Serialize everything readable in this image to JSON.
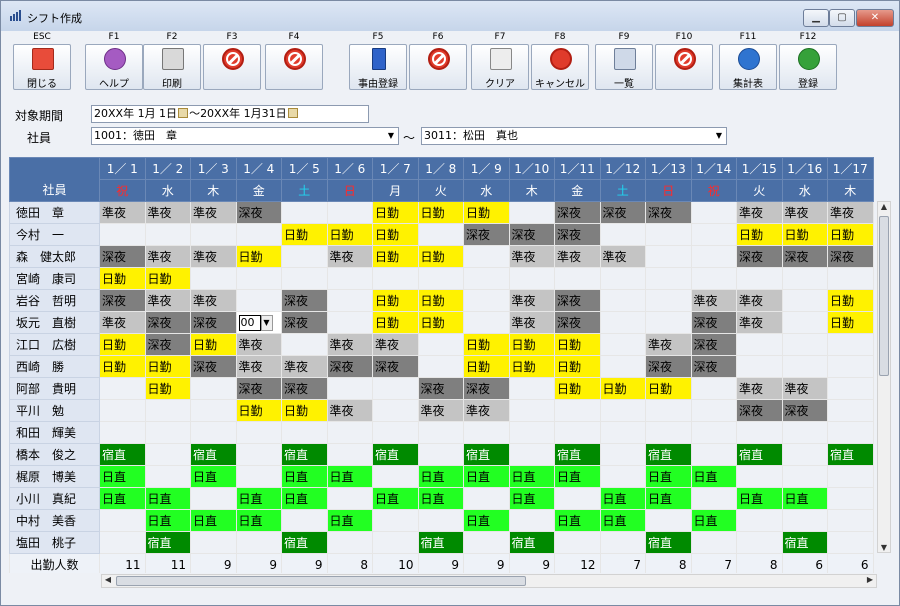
{
  "window": {
    "title": "シフト作成"
  },
  "toolbar": [
    {
      "key": "ESC",
      "label": "閉じる",
      "icon": "close-window-icon"
    },
    {
      "key": "F1",
      "label": "ヘルプ",
      "icon": "help-icon"
    },
    {
      "key": "F2",
      "label": "印刷",
      "icon": "print-icon"
    },
    {
      "key": "F3",
      "label": "",
      "icon": "disabled-icon"
    },
    {
      "key": "F4",
      "label": "",
      "icon": "disabled-icon"
    },
    {
      "key": "F5",
      "label": "事由登録",
      "icon": "book-icon"
    },
    {
      "key": "F6",
      "label": "",
      "icon": "disabled-icon"
    },
    {
      "key": "F7",
      "label": "クリア",
      "icon": "clear-icon"
    },
    {
      "key": "F8",
      "label": "キャンセル",
      "icon": "cancel-icon"
    },
    {
      "key": "F9",
      "label": "一覧",
      "icon": "list-icon"
    },
    {
      "key": "F10",
      "label": "",
      "icon": "disabled-icon"
    },
    {
      "key": "F11",
      "label": "集計表",
      "icon": "info-icon"
    },
    {
      "key": "F12",
      "label": "登録",
      "icon": "check-icon"
    }
  ],
  "form": {
    "period_label": "対象期間",
    "period_from": "20XX年 1月 1日",
    "period_sep": "～",
    "period_to": "20XX年 1月31日",
    "employee_label": "社員",
    "employee_from": "1001：徳田　章",
    "employee_to": "3011：松田　真也",
    "employee_sep": "～"
  },
  "grid": {
    "name_header": "社員",
    "days": [
      {
        "date": "1／ 1",
        "dow": "祝",
        "color": "red"
      },
      {
        "date": "1／ 2",
        "dow": "水",
        "color": ""
      },
      {
        "date": "1／ 3",
        "dow": "木",
        "color": ""
      },
      {
        "date": "1／ 4",
        "dow": "金",
        "color": ""
      },
      {
        "date": "1／ 5",
        "dow": "土",
        "color": "cyan"
      },
      {
        "date": "1／ 6",
        "dow": "日",
        "color": "red"
      },
      {
        "date": "1／ 7",
        "dow": "月",
        "color": ""
      },
      {
        "date": "1／ 8",
        "dow": "火",
        "color": ""
      },
      {
        "date": "1／ 9",
        "dow": "水",
        "color": ""
      },
      {
        "date": "1／10",
        "dow": "木",
        "color": ""
      },
      {
        "date": "1／11",
        "dow": "金",
        "color": ""
      },
      {
        "date": "1／12",
        "dow": "土",
        "color": "cyan"
      },
      {
        "date": "1／13",
        "dow": "日",
        "color": "red"
      },
      {
        "date": "1／14",
        "dow": "祝",
        "color": "red"
      },
      {
        "date": "1／15",
        "dow": "火",
        "color": ""
      },
      {
        "date": "1／16",
        "dow": "水",
        "color": ""
      },
      {
        "date": "1／17",
        "dow": "木",
        "color": ""
      }
    ],
    "rows": [
      {
        "name": "徳田　章",
        "shifts": [
          "準夜",
          "準夜",
          "準夜",
          "深夜",
          "",
          "",
          "日勤",
          "日勤",
          "日勤",
          "",
          "深夜",
          "深夜",
          "深夜",
          "",
          "準夜",
          "準夜",
          "準夜"
        ]
      },
      {
        "name": "今村　一",
        "shifts": [
          "",
          "",
          "",
          "",
          "日勤",
          "日勤",
          "日勤",
          "",
          "深夜",
          "深夜",
          "深夜",
          "",
          "",
          "",
          "日勤",
          "日勤",
          "日勤"
        ]
      },
      {
        "name": "森　健太郎",
        "shifts": [
          "深夜",
          "準夜",
          "準夜",
          "日勤",
          "",
          "準夜",
          "日勤",
          "日勤",
          "",
          "準夜",
          "準夜",
          "準夜",
          "",
          "",
          "深夜",
          "深夜",
          "深夜"
        ]
      },
      {
        "name": "宮崎　康司",
        "shifts": [
          "日勤",
          "日勤",
          "",
          "",
          "",
          "",
          "",
          "",
          "",
          "",
          "",
          "",
          "",
          "",
          "",
          "",
          ""
        ]
      },
      {
        "name": "岩谷　哲明",
        "shifts": [
          "深夜",
          "準夜",
          "準夜",
          "",
          "深夜",
          "",
          "日勤",
          "日勤",
          "",
          "準夜",
          "深夜",
          "",
          "",
          "準夜",
          "準夜",
          "",
          "日勤"
        ]
      },
      {
        "name": "坂元　直樹",
        "shifts": [
          "準夜",
          "深夜",
          "深夜",
          "00",
          "深夜",
          "",
          "日勤",
          "日勤",
          "",
          "準夜",
          "深夜",
          "",
          "",
          "深夜",
          "準夜",
          "",
          "日勤"
        ]
      },
      {
        "name": "江口　広樹",
        "shifts": [
          "日勤",
          "深夜",
          "日勤",
          "準夜",
          "",
          "準夜",
          "準夜",
          "",
          "日勤",
          "日勤",
          "日勤",
          "",
          "準夜",
          "深夜",
          "",
          "",
          ""
        ]
      },
      {
        "name": "西崎　勝",
        "shifts": [
          "日勤",
          "日勤",
          "深夜",
          "準夜",
          "準夜",
          "深夜",
          "深夜",
          "",
          "日勤",
          "日勤",
          "日勤",
          "",
          "深夜",
          "深夜",
          "",
          "",
          ""
        ]
      },
      {
        "name": "阿部　貴明",
        "shifts": [
          "",
          "日勤",
          "",
          "深夜",
          "深夜",
          "",
          "",
          "深夜",
          "深夜",
          "",
          "日勤",
          "日勤",
          "日勤",
          "",
          "準夜",
          "準夜",
          ""
        ]
      },
      {
        "name": "平川　勉",
        "shifts": [
          "",
          "",
          "",
          "日勤",
          "日勤",
          "準夜",
          "",
          "準夜",
          "準夜",
          "",
          "",
          "",
          "",
          "",
          "深夜",
          "深夜",
          ""
        ]
      },
      {
        "name": "和田　輝美",
        "shifts": [
          "",
          "",
          "",
          "",
          "",
          "",
          "",
          "",
          "",
          "",
          "",
          "",
          "",
          "",
          "",
          "",
          ""
        ]
      },
      {
        "name": "橋本　俊之",
        "shifts": [
          "宿直",
          "",
          "宿直",
          "",
          "宿直",
          "",
          "宿直",
          "",
          "宿直",
          "",
          "宿直",
          "",
          "宿直",
          "",
          "宿直",
          "",
          "宿直"
        ]
      },
      {
        "name": "梶原　博美",
        "shifts": [
          "日直",
          "",
          "日直",
          "",
          "日直",
          "日直",
          "",
          "日直",
          "日直",
          "日直",
          "日直",
          "",
          "日直",
          "日直",
          "",
          "",
          ""
        ]
      },
      {
        "name": "小川　真紀",
        "shifts": [
          "日直",
          "日直",
          "",
          "日直",
          "日直",
          "",
          "日直",
          "日直",
          "",
          "日直",
          "",
          "日直",
          "日直",
          "",
          "日直",
          "日直",
          ""
        ]
      },
      {
        "name": "中村　美香",
        "shifts": [
          "",
          "日直",
          "日直",
          "日直",
          "",
          "日直",
          "",
          "",
          "日直",
          "",
          "日直",
          "日直",
          "",
          "日直",
          "",
          "",
          ""
        ]
      },
      {
        "name": "塩田　桃子",
        "shifts": [
          "",
          "宿直",
          "",
          "",
          "宿直",
          "",
          "",
          "宿直",
          "",
          "宿直",
          "",
          "",
          "宿直",
          "",
          "",
          "宿直",
          ""
        ]
      }
    ],
    "count_label": "出勤人数",
    "counts": [
      "11",
      "11",
      "9",
      "9",
      "9",
      "8",
      "10",
      "9",
      "9",
      "9",
      "12",
      "7",
      "8",
      "7",
      "8",
      "6",
      "6"
    ]
  },
  "colors": {
    "header": "#4a6fa6",
    "深夜": "#7f7f7f",
    "準夜": "#c4c4c4",
    "日勤": "#fff200",
    "宿直": "#008a00",
    "日直": "#22ff22"
  }
}
